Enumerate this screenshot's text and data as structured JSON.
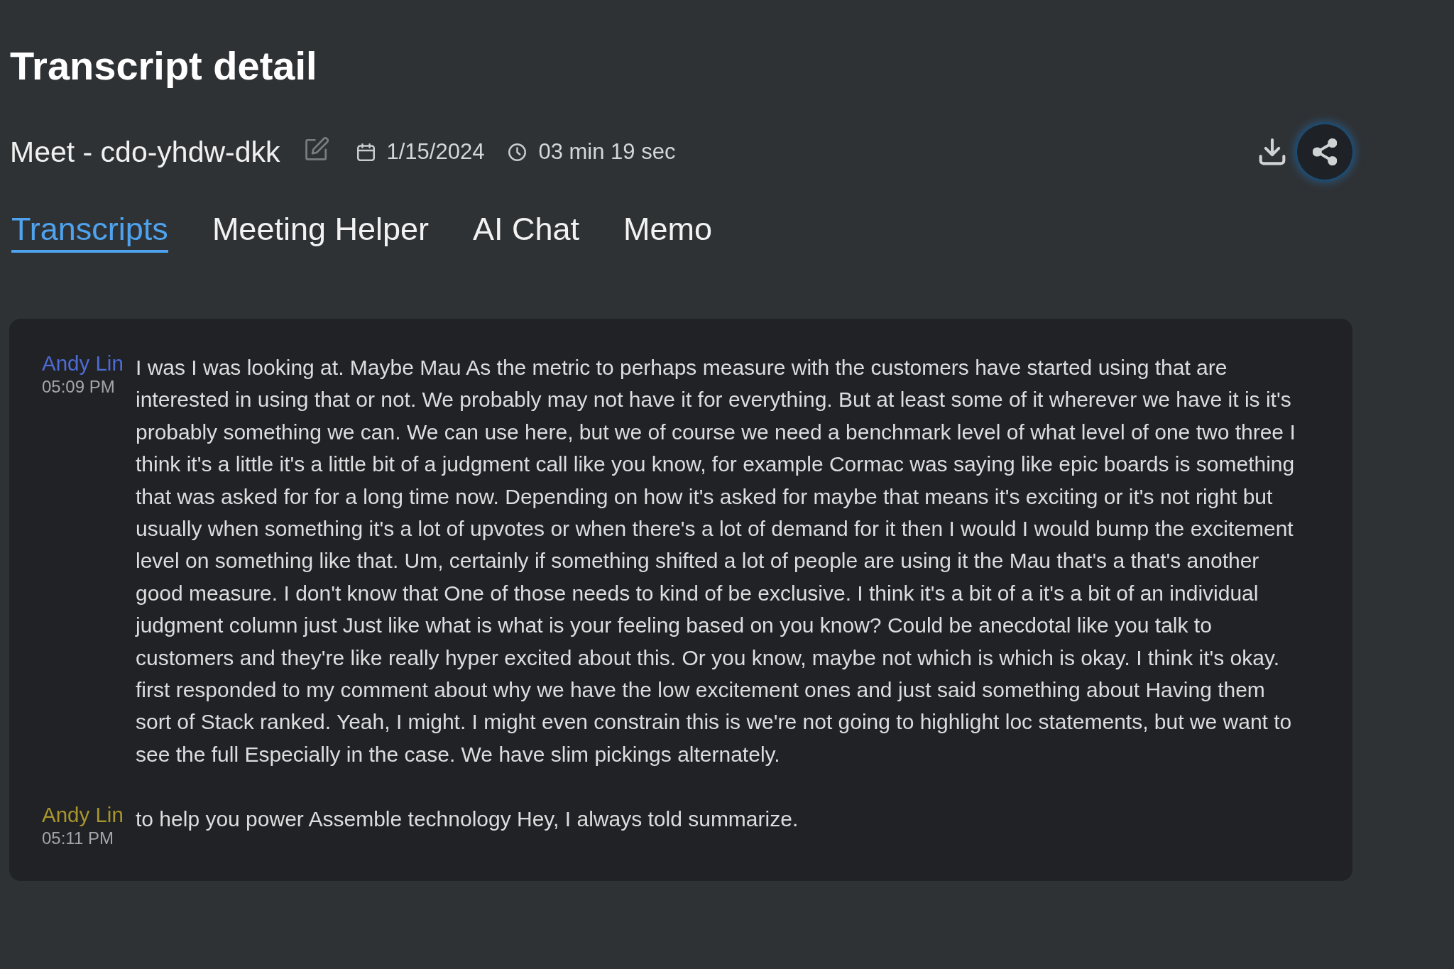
{
  "page": {
    "title": "Transcript detail"
  },
  "meeting": {
    "name": "Meet - cdo-yhdw-dkk",
    "date": "1/15/2024",
    "duration": "03 min 19 sec"
  },
  "actions": [
    {
      "kind": "download",
      "focused": false
    },
    {
      "kind": "share",
      "focused": true
    }
  ],
  "tabs": [
    {
      "label": "Transcripts",
      "selected": true
    },
    {
      "label": "Meeting Helper",
      "selected": false
    },
    {
      "label": "AI Chat",
      "selected": false
    },
    {
      "label": "Memo",
      "selected": false
    }
  ],
  "transcript": {
    "entries": [
      {
        "speaker": "Andy Lin",
        "color": "#4d6cd6",
        "time": "05:09 PM",
        "text": "I was I was looking at. Maybe Mau As the metric to perhaps measure with the customers have started using that are interested in using that or not. We probably may not have it for everything. But at least some of it wherever we have it is it's probably something we can. We can use here, but we of course we need a benchmark level of what level of one two three I think it's a little it's a little bit of a judgment call like you know, for example Cormac was saying like epic boards is something that was asked for for a long time now. Depending on how it's asked for maybe that means it's exciting or it's not right but usually when something it's a lot of upvotes or when there's a lot of demand for it then I would I would bump the excitement level on something like that. Um, certainly if something shifted a lot of people are using it the Mau that's a that's another good measure. I don't know that One of those needs to kind of be exclusive. I think it's a bit of a it's a bit of an individual judgment column just Just like what is what is your feeling based on you know? Could be anecdotal like you talk to customers and they're like really hyper excited about this. Or you know, maybe not which is which is okay. I think it's okay. first responded to my comment about why we have the low excitement ones and just said something about Having them sort of Stack ranked. Yeah, I might. I might even constrain this is we're not going to highlight loc statements, but we want to see the full Especially in the case. We have slim pickings alternately."
      },
      {
        "speaker": "Andy Lin",
        "color": "#a8962c",
        "time": "05:11 PM",
        "text": "to help you power Assemble technology Hey, I always told summarize."
      }
    ]
  }
}
